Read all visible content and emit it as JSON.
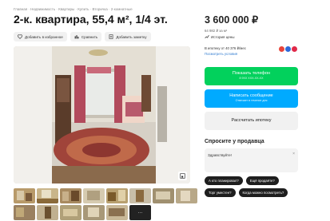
{
  "breadcrumbs": "Главная · Недвижимость · Квартиры · Купить · Вторичка · 2-комнатные",
  "title": "2-к. квартира, 55,4 м², 1/4 эт.",
  "actions": [
    {
      "label": "Добавить в избранное",
      "icon": "heart-icon"
    },
    {
      "label": "Сравнить",
      "icon": "compare-icon"
    },
    {
      "label": "Добавить заметку",
      "icon": "note-icon"
    }
  ],
  "gallery": {
    "more_label": "···"
  },
  "price": {
    "value": "3 600 000 ₽",
    "per_sqm": "64 982 ₽ за м²",
    "history_label": "История цены",
    "mortgage": "В ипотеку от 40 376 ₽/мес",
    "mortgage_link": "Посмотреть условия"
  },
  "buttons": {
    "call_label": "Показать телефон",
    "call_sub": "8 9XX XXX-XX-XX",
    "message_label": "Написать сообщение",
    "message_sub": "Отвечает в течение дня",
    "mortgage_label": "Рассчитать ипотеку"
  },
  "seller": {
    "ask_title": "Спросите у продавца",
    "message_text": "Здравствуйте!",
    "quick_replies": [
      "А кто планировал?",
      "Ещё продаёте?",
      "Торг уместен?",
      "Когда можно посмотреть?"
    ]
  },
  "colors": {
    "green": "#02d15c",
    "blue": "#00aaff"
  }
}
